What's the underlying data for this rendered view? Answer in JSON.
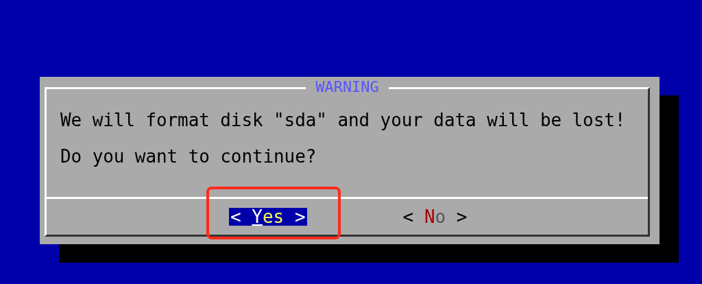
{
  "dialog": {
    "title": "WARNING",
    "lines": [
      "We will format disk \"sda\" and your data will be lost!",
      "Do you want to continue?"
    ],
    "buttons": [
      {
        "open": "<",
        "hotkey": "Y",
        "rest": "es",
        "close": ">",
        "selected": true,
        "highlighted": true
      },
      {
        "open": "<",
        "hotkey": "N",
        "rest": "o",
        "close": ">",
        "selected": false,
        "highlighted": false
      }
    ]
  }
}
